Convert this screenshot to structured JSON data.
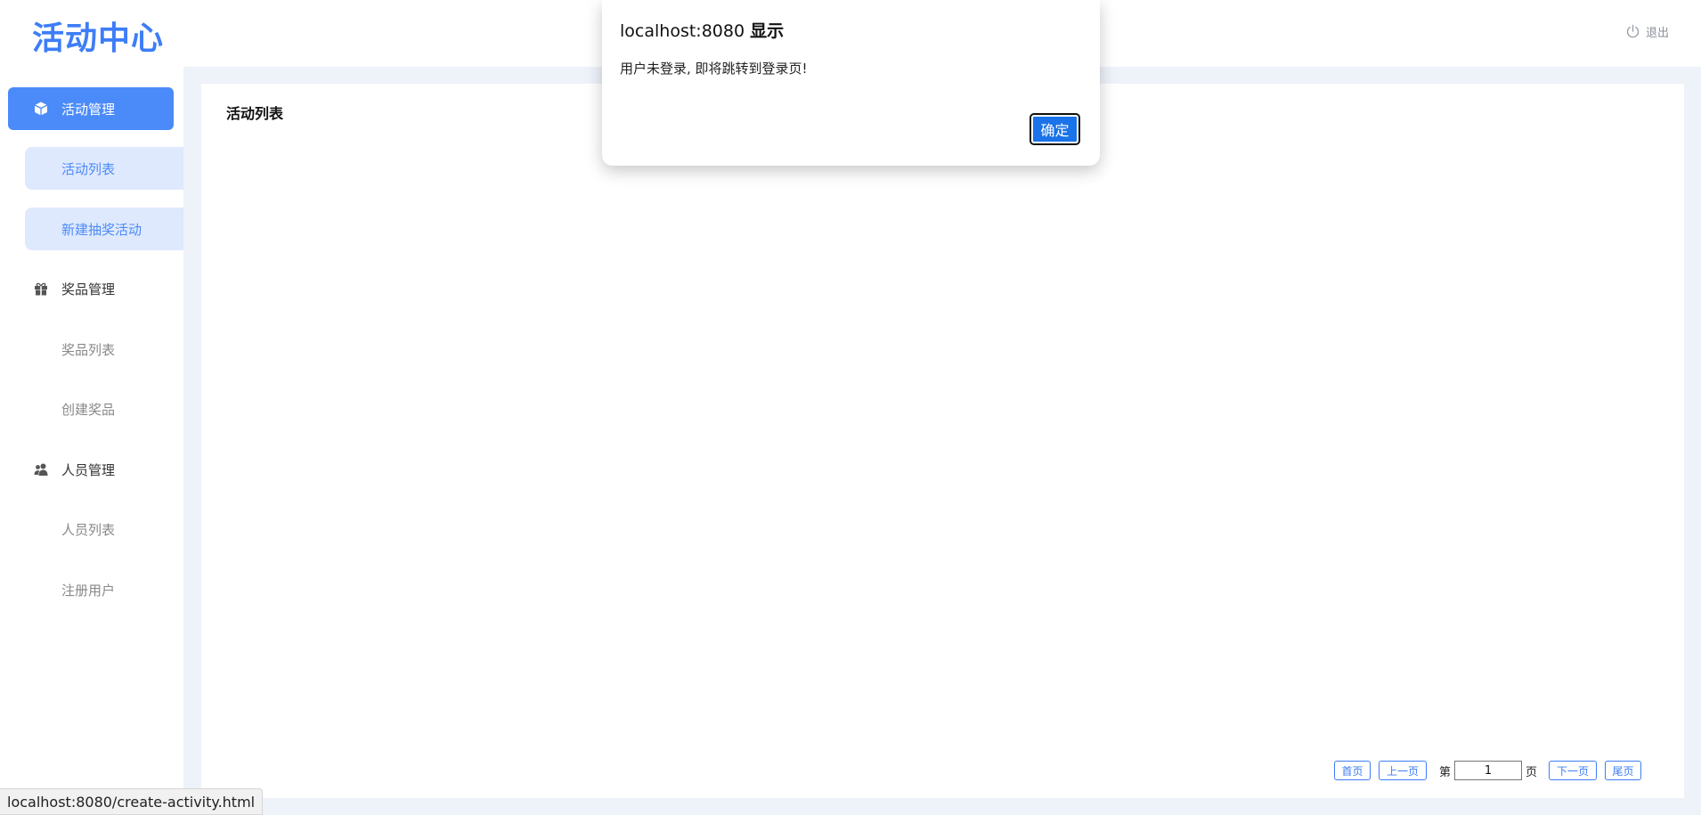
{
  "header": {
    "logo": "活动中心",
    "logout_label": "退出"
  },
  "sidebar": {
    "groups": [
      {
        "label": "活动管理",
        "icon": "cube-icon",
        "active": true,
        "items": [
          {
            "label": "活动列表"
          },
          {
            "label": "新建抽奖活动"
          }
        ]
      },
      {
        "label": "奖品管理",
        "icon": "gift-icon",
        "active": false,
        "items": [
          {
            "label": "奖品列表"
          },
          {
            "label": "创建奖品"
          }
        ]
      },
      {
        "label": "人员管理",
        "icon": "users-icon",
        "active": false,
        "items": [
          {
            "label": "人员列表"
          },
          {
            "label": "注册用户"
          }
        ]
      }
    ]
  },
  "main": {
    "title": "活动列表"
  },
  "pager": {
    "first": "首页",
    "prev": "上一页",
    "page_prefix": "第",
    "page_value": "1",
    "page_suffix": "页",
    "next": "下一页",
    "last": "尾页"
  },
  "dialog": {
    "title_host": "localhost:8080",
    "title_suffix": "显示",
    "message": "用户未登录, 即将跳转到登录页!",
    "ok_label": "确定"
  },
  "statusbar": {
    "url": "localhost:8080/create-activity.html"
  },
  "colors": {
    "accent": "#4b8bf9",
    "accent_light": "#dfe9fd",
    "main_bg": "#eef2f9",
    "dialog_button": "#1a73e8"
  }
}
